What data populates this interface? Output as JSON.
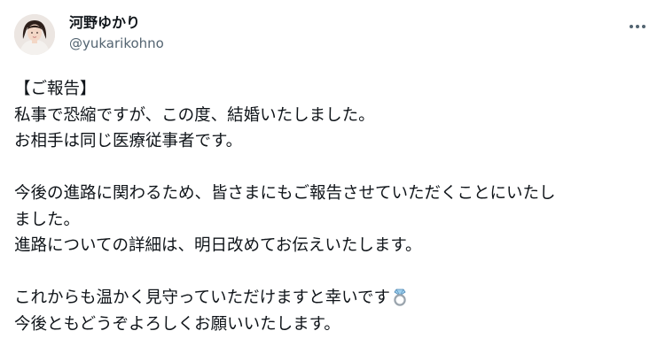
{
  "author": {
    "display_name": "河野ゆかり",
    "handle": "@yukarikohno",
    "avatar_icon": "avatar-photo-icon"
  },
  "menu": {
    "icon": "more-horizontal-icon"
  },
  "post": {
    "lines": [
      "【ご報告】",
      "私事で恐縮ですが、この度、結婚いたしました。",
      "お相手は同じ医療従事者です。",
      "",
      "今後の進路に関わるため、皆さまにもご報告させていただくことにいたし",
      "ました。",
      "進路についての詳細は、明日改めてお伝えいたします。",
      "",
      "これからも温かく見守っていただけますと幸いです",
      "今後ともどうぞよろしくお願いいたします。"
    ],
    "emoji_icon": "ring-icon"
  }
}
